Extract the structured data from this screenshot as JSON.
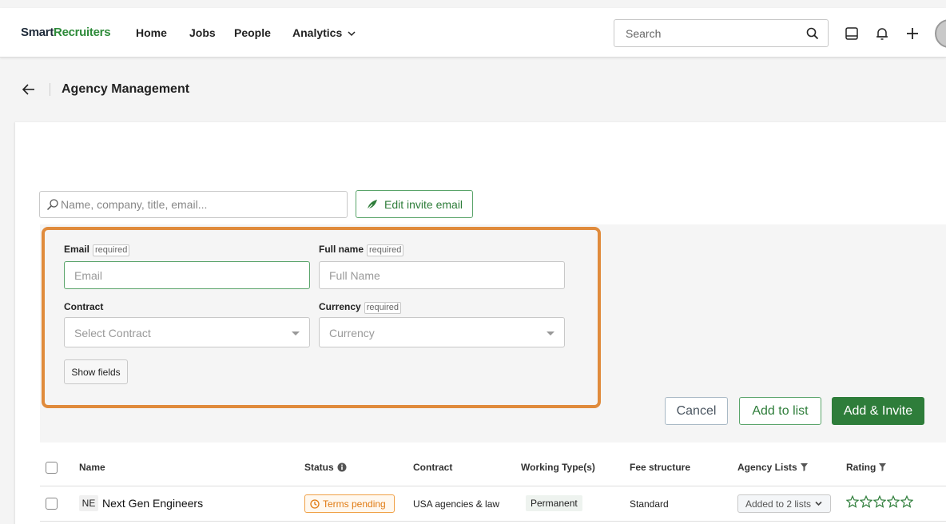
{
  "brand": {
    "part1": "Smart",
    "part2": "Recruiters"
  },
  "nav": {
    "home": "Home",
    "jobs": "Jobs",
    "people": "People",
    "analytics": "Analytics"
  },
  "search": {
    "placeholder": "Search"
  },
  "page": {
    "title": "Agency Management"
  },
  "filter": {
    "placeholder": "Name, company, title, email..."
  },
  "edit_invite": {
    "label": "Edit invite email"
  },
  "form": {
    "email": {
      "label": "Email",
      "required": "required",
      "placeholder": "Email"
    },
    "full_name": {
      "label": "Full name",
      "required": "required",
      "placeholder": "Full Name"
    },
    "contract": {
      "label": "Contract",
      "placeholder": "Select Contract"
    },
    "currency": {
      "label": "Currency",
      "required": "required",
      "placeholder": "Currency"
    },
    "show_fields": "Show fields"
  },
  "actions": {
    "cancel": "Cancel",
    "add_to_list": "Add to list",
    "add_invite": "Add & Invite"
  },
  "table": {
    "columns": {
      "name": "Name",
      "status": "Status",
      "contract": "Contract",
      "working_types": "Working Type(s)",
      "fee_structure": "Fee structure",
      "agency_lists": "Agency Lists",
      "rating": "Rating"
    },
    "rows": [
      {
        "initials": "NE",
        "name": "Next Gen Engineers",
        "status": "Terms pending",
        "contract": "USA agencies & law",
        "working_type": "Permanent",
        "fee_structure": "Standard",
        "agency_lists": "Added to 2 lists",
        "rating": 0
      }
    ]
  },
  "colors": {
    "brand_green": "#2e8b3a",
    "primary_button": "#2e7d3a",
    "highlight_border": "#e08b3c",
    "status_pending": "#e07a12"
  },
  "icons": [
    "search-icon",
    "inbox-icon",
    "bell-icon",
    "plus-icon",
    "back-arrow-icon",
    "magnifier-icon",
    "pencil-leaf-icon",
    "info-icon",
    "filter-icon",
    "clock-icon",
    "chevron-down-icon",
    "star-icon"
  ]
}
